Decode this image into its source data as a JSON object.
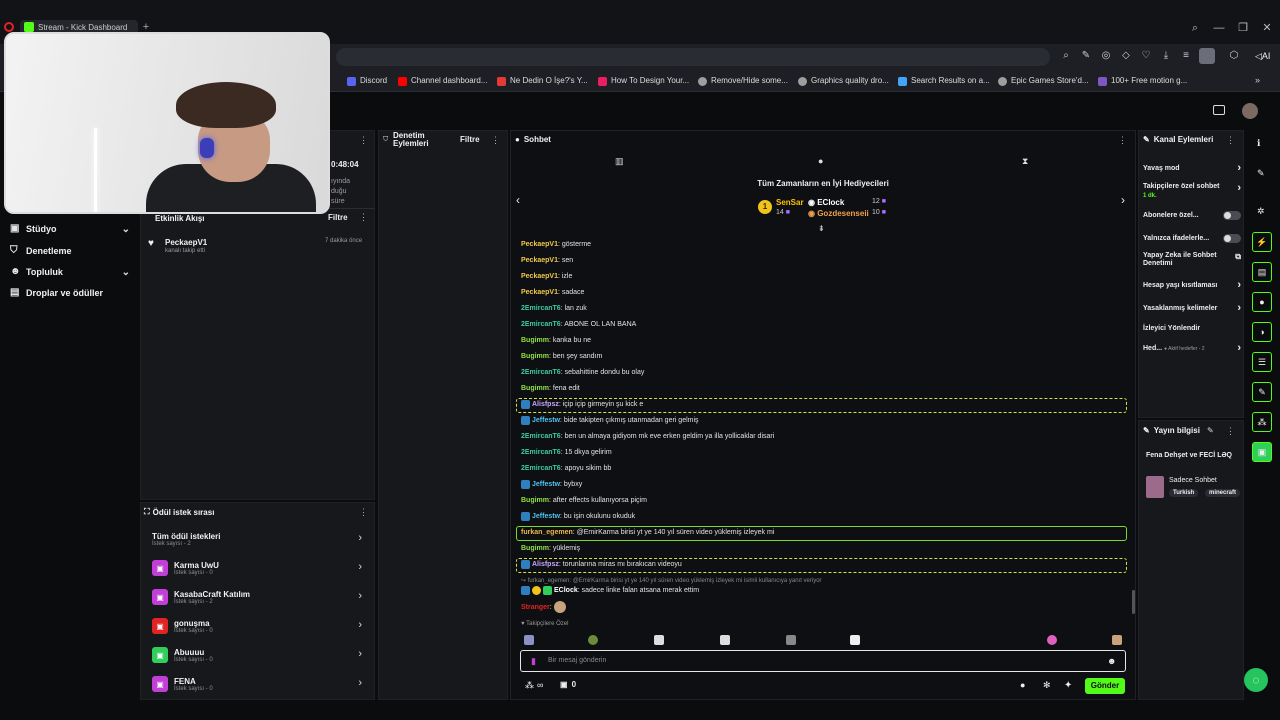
{
  "browser": {
    "tab_title": "Stream - Kick Dashboard",
    "bookmarks": [
      {
        "label": "Discord",
        "color": "#5865f2"
      },
      {
        "label": "Channel dashboard...",
        "color": "#ff0000"
      },
      {
        "label": "Ne Dedin O İşe?'s Y...",
        "color": "#e53935"
      },
      {
        "label": "How To Design Your...",
        "color": "#e91e63"
      },
      {
        "label": "Remove/Hide some...",
        "color": "#9e9e9e"
      },
      {
        "label": "Graphics quality dro...",
        "color": "#9e9e9e"
      },
      {
        "label": "Search Results on a...",
        "color": "#42a5f5"
      },
      {
        "label": "Epic Games Store'd...",
        "color": "#9e9e9e"
      },
      {
        "label": "100+ Free motion g...",
        "color": "#7e57c2"
      }
    ],
    "ai_label": "AI"
  },
  "leftnav": {
    "items": [
      {
        "label": "Stüdyo",
        "icon": "studio-icon",
        "expand": true
      },
      {
        "label": "Denetleme",
        "icon": "shield-icon",
        "expand": false
      },
      {
        "label": "Topluluk",
        "icon": "people-icon",
        "expand": true
      },
      {
        "label": "Droplar ve ödüller",
        "icon": "gift-icon",
        "expand": false
      }
    ]
  },
  "activity": {
    "time": "0:48:04",
    "partial_line1": "ıyında",
    "partial_line2": "duğu",
    "partial_line3": "süre",
    "feed_title": "Etkinlik Akışı",
    "filter_label": "Filtre",
    "events": [
      {
        "user": "PeckaepV1",
        "text": "kanalı takip etti",
        "time": "7 dakika önce"
      }
    ]
  },
  "reward_queue": {
    "title": "Ödül istek sırası",
    "items": [
      {
        "title": "Tüm ödül istekleri",
        "sub": "İstek sayısı - 2",
        "color": "",
        "icon": ""
      },
      {
        "title": "Karma UwU",
        "sub": "İstek sayısı - 0",
        "color": "#c13fd6",
        "icon": "reward-icon"
      },
      {
        "title": "KasabaCraft Katılım",
        "sub": "İstek sayısı - 2",
        "color": "#c13fd6",
        "icon": "reward-icon"
      },
      {
        "title": "gonuşma",
        "sub": "İstek sayısı - 0",
        "color": "#e02424",
        "icon": "reward-icon"
      },
      {
        "title": "Abuuuu",
        "sub": "İstek sayısı - 0",
        "color": "#2fcf5a",
        "icon": "reward-icon"
      },
      {
        "title": "FENA",
        "sub": "İstek sayısı - 0",
        "color": "#c13fd6",
        "icon": "reward-icon"
      }
    ]
  },
  "moderation": {
    "title": "Denetim Eylemleri",
    "filter_label": "Filtre"
  },
  "chat": {
    "title": "Sohbet",
    "gifters_title": "Tüm Zamanların en İyi Hediyecileri",
    "gifters": [
      {
        "name": "SenSar",
        "count": "14",
        "color": "#ffc107"
      },
      {
        "name": "EClock",
        "count": "12",
        "color": "#ffffff"
      },
      {
        "name": "Gozdesenseii",
        "count": "10",
        "color": "#f0a04b"
      }
    ],
    "gifter_rank": "1",
    "messages": [
      {
        "user": "PeckaepV1",
        "color": "#f0c84a",
        "text": ": gösterme",
        "style": "plain",
        "badge": false
      },
      {
        "user": "PeckaepV1",
        "color": "#f0c84a",
        "text": ": sen",
        "style": "plain",
        "badge": false
      },
      {
        "user": "PeckaepV1",
        "color": "#f0c84a",
        "text": ": izle",
        "style": "plain",
        "badge": false
      },
      {
        "user": "PeckaepV1",
        "color": "#f0c84a",
        "text": ": sadace",
        "style": "plain",
        "badge": false
      },
      {
        "user": "2EmircanT6",
        "color": "#3fc9a0",
        "text": ": lan zuk",
        "style": "plain",
        "badge": false
      },
      {
        "user": "2EmircanT6",
        "color": "#3fc9a0",
        "text": ": ABONE OL LAN BANA",
        "style": "plain",
        "badge": false
      },
      {
        "user": "Bugimm",
        "color": "#8fe14a",
        "text": ": kanka bu ne",
        "style": "plain",
        "badge": false
      },
      {
        "user": "Bugimm",
        "color": "#8fe14a",
        "text": ": ben şey sandım",
        "style": "plain",
        "badge": false
      },
      {
        "user": "2EmircanT6",
        "color": "#3fc9a0",
        "text": ": sebahittine dondu bu olay",
        "style": "plain",
        "badge": false
      },
      {
        "user": "Bugimm",
        "color": "#8fe14a",
        "text": ": fena edit",
        "style": "plain",
        "badge": false
      },
      {
        "user": "Alisfpsz",
        "color": "#c4a7ff",
        "text": ": içip içip girmeyin şu kick e",
        "style": "dashed",
        "badge": true
      },
      {
        "user": "Jeffestw",
        "color": "#4ec3f0",
        "text": ": bide takipten çıkmış utanmadan geri gelmiş",
        "style": "plain",
        "badge": true
      },
      {
        "user": "2EmircanT6",
        "color": "#3fc9a0",
        "text": ": ben un almaya gidiyom mk eve erken geldim ya illa yollicaklar disari",
        "style": "plain",
        "badge": false
      },
      {
        "user": "2EmircanT6",
        "color": "#3fc9a0",
        "text": ": 15 dkya gelirim",
        "style": "plain",
        "badge": false
      },
      {
        "user": "2EmircanT6",
        "color": "#3fc9a0",
        "text": ": apoyu sikim bb",
        "style": "plain",
        "badge": false
      },
      {
        "user": "Jeffestw",
        "color": "#4ec3f0",
        "text": ": bybxy",
        "style": "plain",
        "badge": true
      },
      {
        "user": "Bugimm",
        "color": "#8fe14a",
        "text": ": after effects kullanıyorsa piçim",
        "style": "plain",
        "badge": false
      },
      {
        "user": "Jeffestw",
        "color": "#4ec3f0",
        "text": ": bu işin okulunu okuduk",
        "style": "plain",
        "badge": true
      },
      {
        "user": "furkan_egemen",
        "color": "#f0b64a",
        "text": ": @EmirKarma birisi yt ye 140 yıl süren video yüklemiş izleyek mi",
        "style": "solid",
        "badge": false
      },
      {
        "user": "Bugimm",
        "color": "#8fe14a",
        "text": ": yüklemiş",
        "style": "plain",
        "badge": false
      },
      {
        "user": "Alisfpsz",
        "color": "#c4a7ff",
        "text": ": torunlarına miras mı bırakıcan videoyu",
        "style": "dashed",
        "badge": true
      }
    ],
    "reply_context": "↪ furkan_egemen: @EmirKarma birisi yt ye 140 yıl süren video yüklemiş izleyek mi isimli kullanıcıya yanıt veriyor",
    "reply_user": "EClock",
    "reply_text": ": sadece linke falan atsana merak ettim",
    "last_user": "Stranger",
    "followers_only": "Takipçilere Özel",
    "input_placeholder": "Bir mesaj gönderin",
    "infinity": "∞",
    "counter": "0",
    "send_label": "Gönder"
  },
  "channel_actions": {
    "title": "Kanal Eylemleri",
    "rows": [
      {
        "label": "Yavaş mod",
        "sub": "",
        "control": "chevron"
      },
      {
        "label": "Takipçilere özel sohbet",
        "sub": "1 dk.",
        "control": "chevron"
      },
      {
        "label": "Abonelere özel...",
        "sub": "",
        "control": "toggle"
      },
      {
        "label": "Yalnızca ifadelerle...",
        "sub": "",
        "control": "toggle"
      },
      {
        "label": "Yapay Zeka ile Sohbet Denetimi",
        "sub": "",
        "control": "link"
      },
      {
        "label": "Hesap yaşı kısıtlaması",
        "sub": "",
        "control": "chevron"
      },
      {
        "label": "Yasaklanmış kelimeler",
        "sub": "",
        "control": "chevron"
      },
      {
        "label": "İzleyici Yönlendir",
        "sub": "",
        "control": "none"
      },
      {
        "label": "Hed...",
        "sub": "● Aktif hedefler - 2",
        "control": "chevron"
      }
    ]
  },
  "stream_info": {
    "title": "Yayın bilgisi",
    "stream_title": "Fena Dehşet ve FECİ LƏQ",
    "category": "Sadece Sohbet",
    "tags": [
      "Turkish",
      "minecraft"
    ]
  }
}
